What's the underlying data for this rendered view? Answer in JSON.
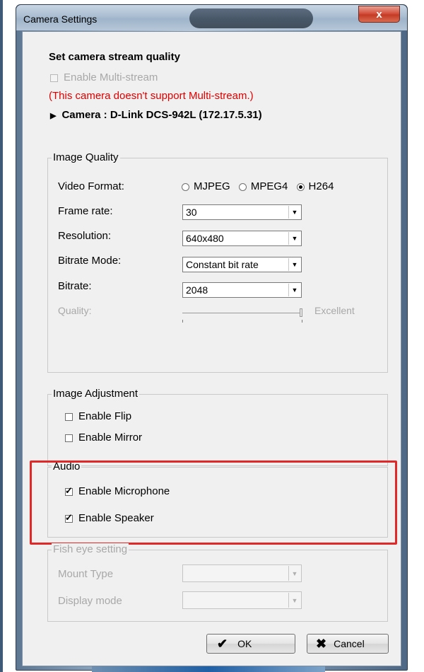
{
  "window": {
    "title": "Camera Settings",
    "close_symbol": "x"
  },
  "stream": {
    "heading": "Set camera stream quality",
    "multistream_label": "Enable Multi-stream",
    "multistream_checked": false,
    "multistream_enabled": false,
    "notice": "(This camera doesn't support Multi-stream.)",
    "camera_label": "Camera : D-Link DCS-942L (172.17.5.31)"
  },
  "image_quality": {
    "title": "Image Quality",
    "video_format_label": "Video Format:",
    "formats": [
      "MJPEG",
      "MPEG4",
      "H264"
    ],
    "selected_format": "H264",
    "frame_rate_label": "Frame rate:",
    "frame_rate_value": "30",
    "resolution_label": "Resolution:",
    "resolution_value": "640x480",
    "bitrate_mode_label": "Bitrate Mode:",
    "bitrate_mode_value": "Constant bit rate",
    "bitrate_label": "Bitrate:",
    "bitrate_value": "2048",
    "quality_label": "Quality:",
    "quality_max_label": "Excellent",
    "quality_level": 1.0
  },
  "image_adjustment": {
    "title": "Image Adjustment",
    "flip_label": "Enable Flip",
    "flip_checked": false,
    "mirror_label": "Enable Mirror",
    "mirror_checked": false
  },
  "audio": {
    "title": "Audio",
    "microphone_label": "Enable Microphone",
    "microphone_checked": true,
    "speaker_label": "Enable Speaker",
    "speaker_checked": true,
    "highlight_color": "#e02828"
  },
  "fisheye": {
    "title": "Fish eye setting",
    "mount_type_label": "Mount Type",
    "mount_type_value": "",
    "display_mode_label": "Display mode",
    "display_mode_value": ""
  },
  "buttons": {
    "ok_label": "OK",
    "cancel_label": "Cancel",
    "ok_icon": "checkmark-icon",
    "cancel_icon": "x-icon"
  }
}
